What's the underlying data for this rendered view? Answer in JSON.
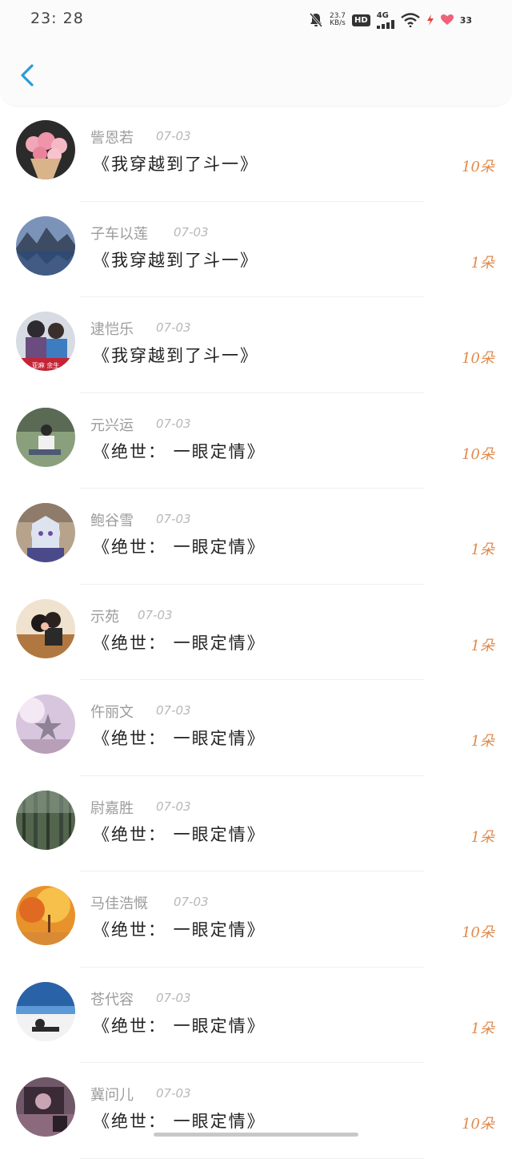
{
  "status_bar": {
    "time": "23: 28",
    "net_speed_value": "23.7",
    "net_speed_unit": "KB/s",
    "hd_label": "HD",
    "network_label": "4G",
    "battery_level": "33",
    "icons": [
      "mute-bell-icon",
      "signal-icon",
      "wifi-icon",
      "charging-icon",
      "battery-icon"
    ]
  },
  "header": {
    "back_icon": "chevron-left-icon",
    "accent_color": "#2b9bd8"
  },
  "list": [
    {
      "name": "訾恩若",
      "date": "07-03",
      "book": "《我穿越到了斗一》",
      "count": "10朵"
    },
    {
      "name": "子车以莲",
      "date": "07-03",
      "book": "《我穿越到了斗一》",
      "count": "1朵"
    },
    {
      "name": "逮恺乐",
      "date": "07-03",
      "book": "《我穿越到了斗一》",
      "count": "10朵"
    },
    {
      "name": "元兴运",
      "date": "07-03",
      "book": "《绝世： 一眼定情》",
      "count": "10朵"
    },
    {
      "name": "鲍谷雪",
      "date": "07-03",
      "book": "《绝世： 一眼定情》",
      "count": "1朵"
    },
    {
      "name": "示苑",
      "date": "07-03",
      "book": "《绝世： 一眼定情》",
      "count": "1朵"
    },
    {
      "name": "仵丽文",
      "date": "07-03",
      "book": "《绝世： 一眼定情》",
      "count": "1朵"
    },
    {
      "name": "尉嘉胜",
      "date": "07-03",
      "book": "《绝世： 一眼定情》",
      "count": "1朵"
    },
    {
      "name": "马佳浩慨",
      "date": "07-03",
      "book": "《绝世： 一眼定情》",
      "count": "10朵"
    },
    {
      "name": "苍代容",
      "date": "07-03",
      "book": "《绝世： 一眼定情》",
      "count": "1朵"
    },
    {
      "name": "冀问儿",
      "date": "07-03",
      "book": "《绝世： 一眼定情》",
      "count": "10朵"
    }
  ],
  "colors": {
    "name": "#9c9c9c",
    "date": "#b8b8b8",
    "book": "#222222",
    "count": "#e08a4c"
  }
}
